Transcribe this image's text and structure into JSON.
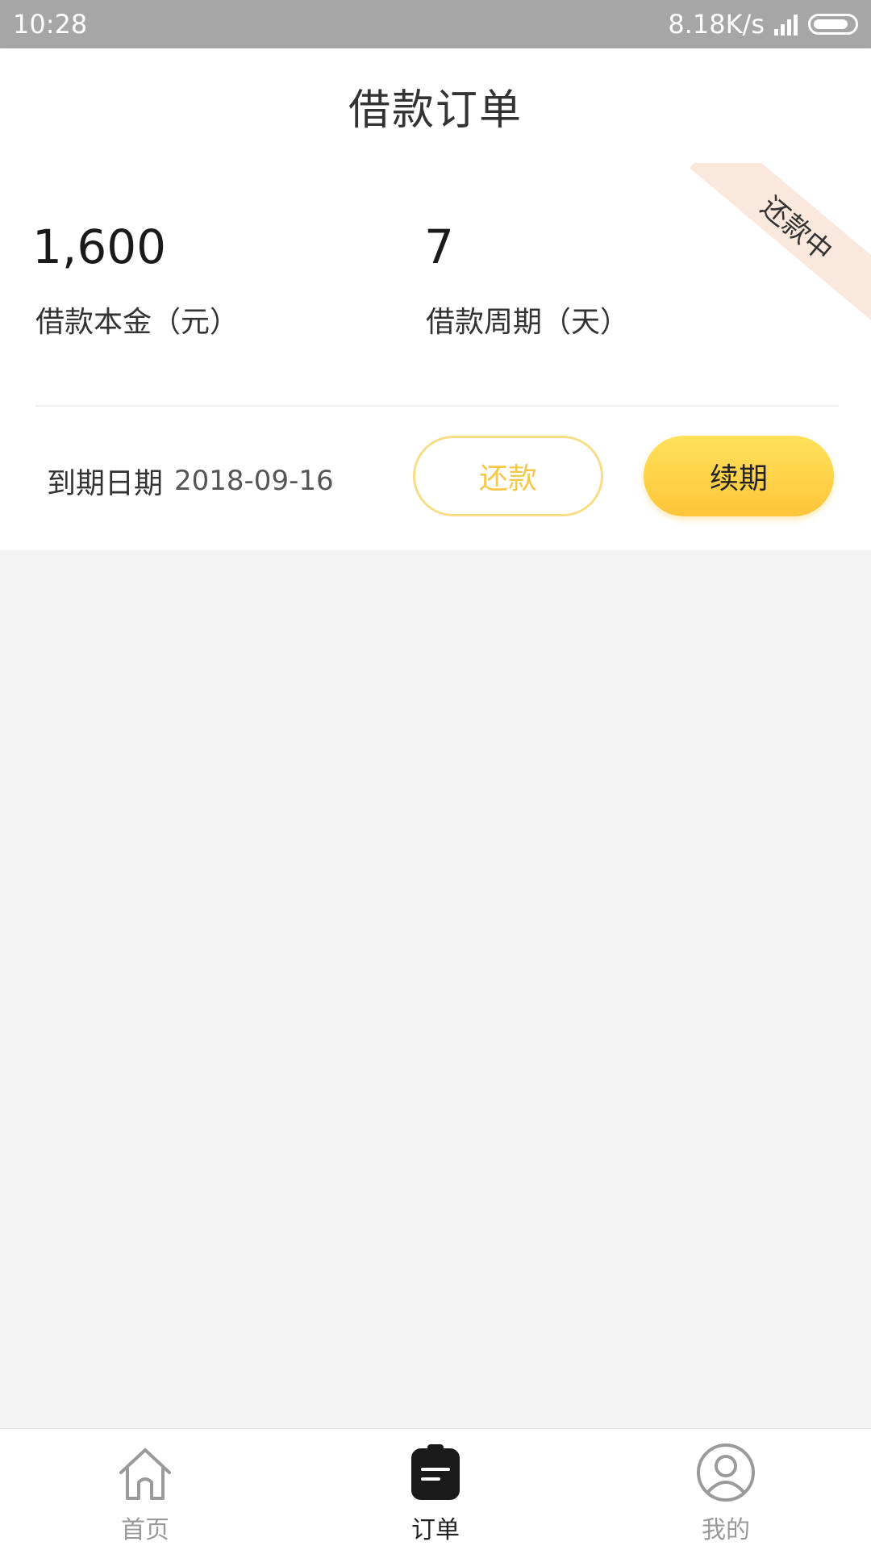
{
  "status_bar": {
    "time": "10:28",
    "network_speed": "8.18K/s"
  },
  "header": {
    "title": "借款订单"
  },
  "order": {
    "status_badge": "还款中",
    "principal_value": "1,600",
    "principal_label": "借款本金（元）",
    "period_value": "7",
    "period_label": "借款周期（天）",
    "due_label": "到期日期",
    "due_date": "2018-09-16",
    "repay_button": "还款",
    "renew_button": "续期"
  },
  "tabbar": {
    "items": [
      {
        "label": "首页",
        "icon": "home-icon",
        "active": false
      },
      {
        "label": "订单",
        "icon": "order-clipboard-icon",
        "active": true
      },
      {
        "label": "我的",
        "icon": "profile-icon",
        "active": false
      }
    ]
  },
  "colors": {
    "accent_yellow": "#fdc53a",
    "badge_bg": "#fbe8dd",
    "page_bg": "#f3f3f3"
  }
}
